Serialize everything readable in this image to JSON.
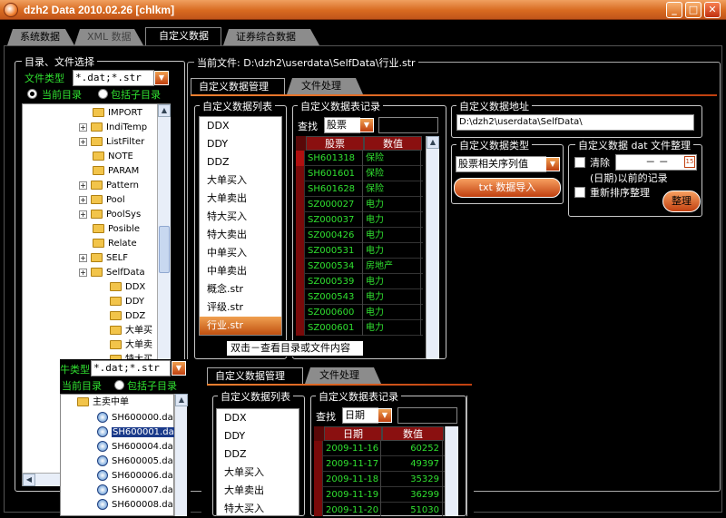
{
  "window": {
    "title": "dzh2 Data 2010.02.26 [chlkm]",
    "min_label": "_",
    "max_label": "□",
    "close_label": "✕"
  },
  "tabs": [
    "系统数据",
    "XML 数据",
    "自定义数据",
    "证券综合数据"
  ],
  "left_panel": {
    "title": "目录、文件选择",
    "filetype_label": "文件类型",
    "filetype_value": "*.dat;*.str",
    "radio_current": "当前目录",
    "radio_sub": "包括子目录",
    "tree": [
      {
        "label": "IMPORT",
        "plus": false
      },
      {
        "label": "IndiTemp",
        "plus": true
      },
      {
        "label": "ListFilter",
        "plus": true
      },
      {
        "label": "NOTE",
        "plus": false
      },
      {
        "label": "PARAM",
        "plus": false
      },
      {
        "label": "Pattern",
        "plus": true
      },
      {
        "label": "Pool",
        "plus": true
      },
      {
        "label": "PoolSys",
        "plus": true
      },
      {
        "label": "Posible",
        "plus": false
      },
      {
        "label": "Relate",
        "plus": false
      },
      {
        "label": "SELF",
        "plus": true
      },
      {
        "label": "SelfData",
        "plus": true
      }
    ],
    "subtree": [
      "DDX",
      "DDY",
      "DDZ",
      "大单买",
      "大单卖",
      "特大买"
    ]
  },
  "current_file": {
    "label": "当前文件:",
    "path": "D:\\dzh2\\userdata\\SelfData\\行业.str"
  },
  "sub_tabs": [
    "自定义数据管理",
    "文件处理"
  ],
  "list_panel": {
    "title": "自定义数据列表",
    "items": [
      "DDX",
      "DDY",
      "DDZ",
      "大单买入",
      "大单卖出",
      "特大买入",
      "特大卖出",
      "中单买入",
      "中单卖出",
      "概念.str",
      "评级.str",
      "行业.str"
    ],
    "selected_index": 11,
    "tooltip": "双击－查看目录或文件内容"
  },
  "records_panel": {
    "title": "自定义数据表记录",
    "search_label": "查找",
    "search_field": "股票",
    "headers": [
      "股票",
      "数值"
    ],
    "rows": [
      [
        "SH601318",
        "保险"
      ],
      [
        "SH601601",
        "保险"
      ],
      [
        "SH601628",
        "保险"
      ],
      [
        "SZ000027",
        "电力"
      ],
      [
        "SZ000037",
        "电力"
      ],
      [
        "SZ000426",
        "电力"
      ],
      [
        "SZ000531",
        "电力"
      ],
      [
        "SZ000534",
        "房地产"
      ],
      [
        "SZ000539",
        "电力"
      ],
      [
        "SZ000543",
        "电力"
      ],
      [
        "SZ000600",
        "电力"
      ],
      [
        "SZ000601",
        "电力"
      ]
    ]
  },
  "address_panel": {
    "title": "自定义数据地址",
    "value": "D:\\dzh2\\userdata\\SelfData\\"
  },
  "type_panel": {
    "title": "自定义数据类型",
    "select_value": "股票相关序列值",
    "import_btn": "txt 数据导入"
  },
  "cleanup_panel": {
    "title": "自定义数据 dat 文件整理",
    "clear_label": "清除",
    "date_value": "－  －",
    "before_label": "(日期)以前的记录",
    "resort_label": "重新排序整理",
    "btn": "整理",
    "cal_icon": "15"
  },
  "overlay": {
    "filetype_prefix": "牛类型",
    "filetype_value": "*.dat;*.str",
    "radio_current": "当前目录",
    "radio_sub": "包括子目录",
    "folder": "主卖中单",
    "files": [
      "SH600000.da",
      "SH600001.da",
      "SH600004.da",
      "SH600005.da",
      "SH600006.da",
      "SH600007.da",
      "SH600008.da"
    ],
    "selected_file": 1,
    "sub_tabs": [
      "自定义数据管理",
      "文件处理"
    ],
    "list_title": "自定义数据列表",
    "list_items": [
      "DDX",
      "DDY",
      "DDZ",
      "大单买入",
      "大单卖出",
      "特大买入"
    ],
    "records_title": "自定义数据表记录",
    "search_label": "查找",
    "search_field": "日期",
    "headers": [
      "日期",
      "数值"
    ],
    "rows": [
      [
        "2009-11-16",
        "60252"
      ],
      [
        "2009-11-17",
        "49397"
      ],
      [
        "2009-11-18",
        "35329"
      ],
      [
        "2009-11-19",
        "36299"
      ],
      [
        "2009-11-20",
        "51030"
      ]
    ]
  },
  "colors": {
    "accent": "#d86a20",
    "grid_head": "#8a1010",
    "grid_text": "#30e030"
  }
}
